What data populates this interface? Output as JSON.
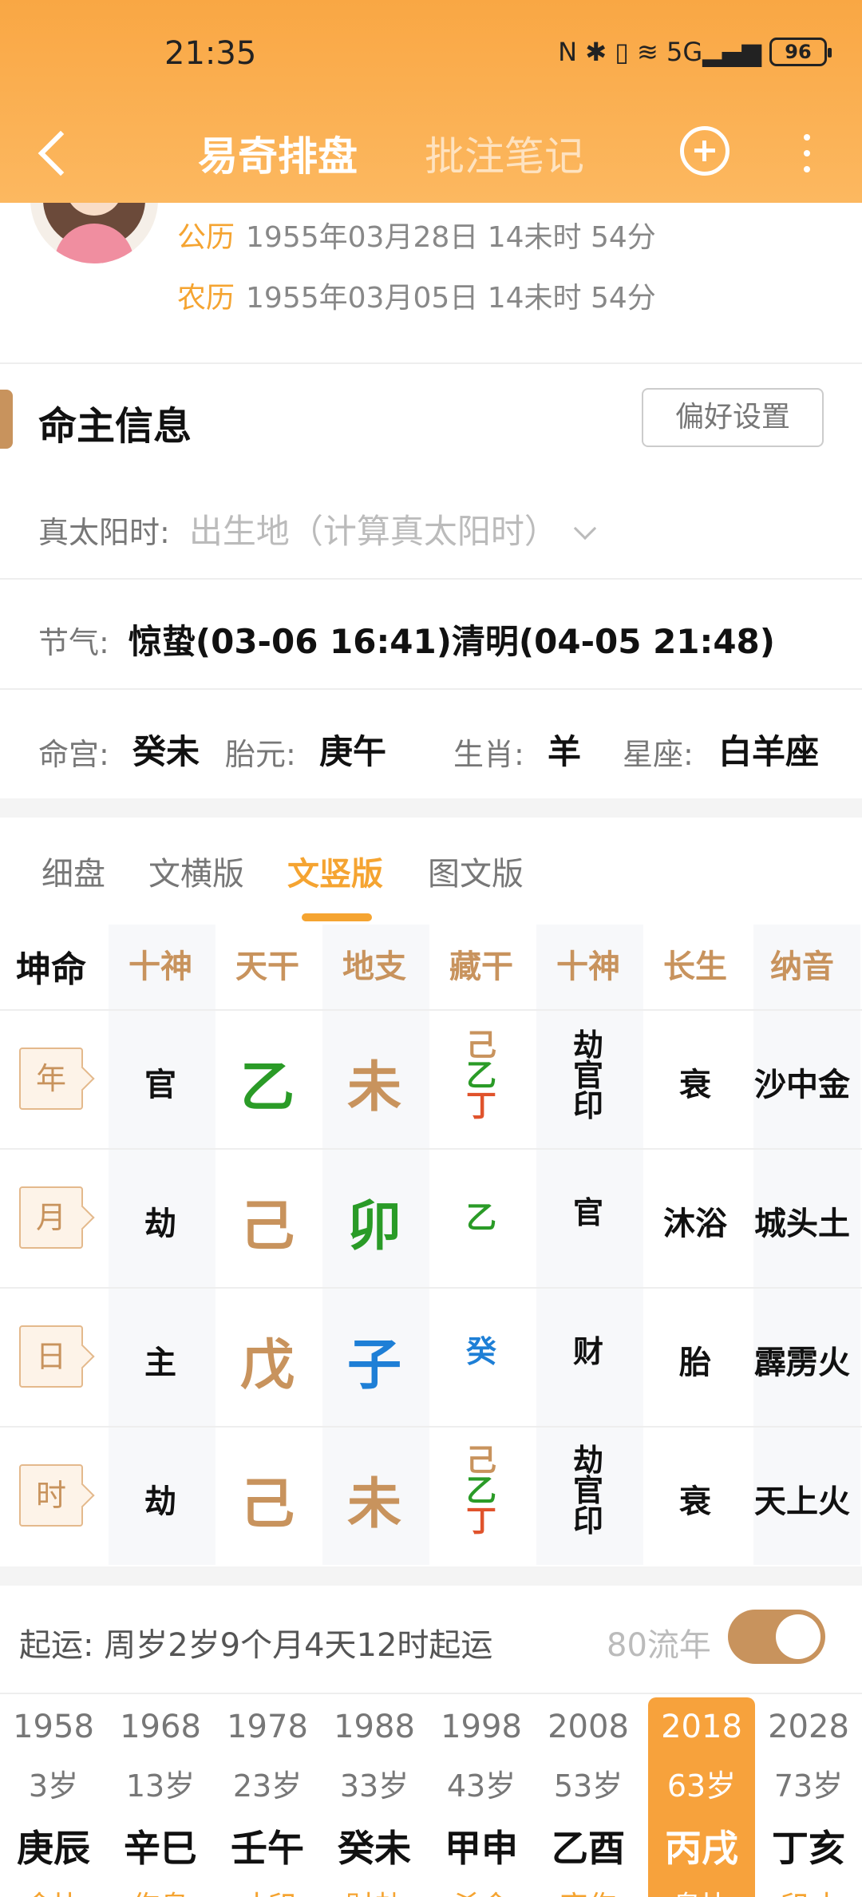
{
  "status": {
    "time": "21:35",
    "icons_text": "N ✱ ▯ ≋ 5G▂▄▆",
    "battery": "96"
  },
  "nav": {
    "tab_active": "易奇排盘",
    "tab_inactive": "批注笔记"
  },
  "profile": {
    "solar_label": "公历",
    "solar_value": "1955年03月28日 14未时 54分",
    "lunar_label": "农历",
    "lunar_value": "1955年03月05日 14未时 54分"
  },
  "section": {
    "title": "命主信息",
    "pref_button": "偏好设置"
  },
  "info": {
    "true_sun_label": "真太阳时:",
    "true_sun_placeholder": "出生地（计算真太阳时）",
    "jieqi_label": "节气:",
    "jieqi_value": "惊蛰(03-06 16:41)清明(04-05 21:48)",
    "minggong_label": "命宫:",
    "minggong_value": "癸未",
    "taiyuan_label": "胎元:",
    "taiyuan_value": "庚午",
    "shengxiao_label": "生肖:",
    "shengxiao_value": "羊",
    "xingzuo_label": "星座:",
    "xingzuo_value": "白羊座"
  },
  "subtabs": [
    "细盘",
    "文横版",
    "文竖版",
    "图文版"
  ],
  "active_subtab": "文竖版",
  "table": {
    "corner": "坤命",
    "headers": [
      "十神",
      "天干",
      "地支",
      "藏干",
      "十神",
      "长生",
      "纳音"
    ],
    "rows": [
      {
        "pillar": "年",
        "shishen": "官",
        "tiangan": "乙",
        "dizhi": "未",
        "canggan": [
          "己",
          "乙",
          "丁"
        ],
        "shishen2": [
          "劫",
          "官",
          "印"
        ],
        "changsheng": "衰",
        "nayin": "沙中金"
      },
      {
        "pillar": "月",
        "shishen": "劫",
        "tiangan": "己",
        "dizhi": "卯",
        "canggan": [
          "乙"
        ],
        "shishen2": [
          "官"
        ],
        "changsheng": "沐浴",
        "nayin": "城头土"
      },
      {
        "pillar": "日",
        "shishen": "主",
        "tiangan": "戊",
        "dizhi": "子",
        "canggan": [
          "癸"
        ],
        "shishen2": [
          "财"
        ],
        "changsheng": "胎",
        "nayin": "霹雳火"
      },
      {
        "pillar": "时",
        "shishen": "劫",
        "tiangan": "己",
        "dizhi": "未",
        "canggan": [
          "己",
          "乙",
          "丁"
        ],
        "shishen2": [
          "劫",
          "官",
          "印"
        ],
        "changsheng": "衰",
        "nayin": "天上火"
      }
    ]
  },
  "colors": {
    "earth": "#c8935d",
    "wood": "#2a9b27",
    "fire": "#e0532c",
    "water": "#1e7fd6",
    "accent": "#f5a431"
  },
  "qiyun": {
    "text": "起运:  周岁2岁9个月4天12时起运",
    "liunian_label": "80流年",
    "toggle_on": true
  },
  "dayun": [
    {
      "year": "1958",
      "age": "3岁",
      "ganzhi": "庚辰",
      "shishen": "食比"
    },
    {
      "year": "1968",
      "age": "13岁",
      "ganzhi": "辛巳",
      "shishen": "伤枭"
    },
    {
      "year": "1978",
      "age": "23岁",
      "ganzhi": "壬午",
      "shishen": "才印"
    },
    {
      "year": "1988",
      "age": "33岁",
      "ganzhi": "癸未",
      "shishen": "财劫"
    },
    {
      "year": "1998",
      "age": "43岁",
      "ganzhi": "甲申",
      "shishen": "杀食"
    },
    {
      "year": "2008",
      "age": "53岁",
      "ganzhi": "乙酉",
      "shishen": "官伤"
    },
    {
      "year": "2018",
      "age": "63岁",
      "ganzhi": "丙戌",
      "shishen": "枭比"
    },
    {
      "year": "2028",
      "age": "73岁",
      "ganzhi": "丁亥",
      "shishen": "印才"
    }
  ],
  "active_dayun": "2018"
}
